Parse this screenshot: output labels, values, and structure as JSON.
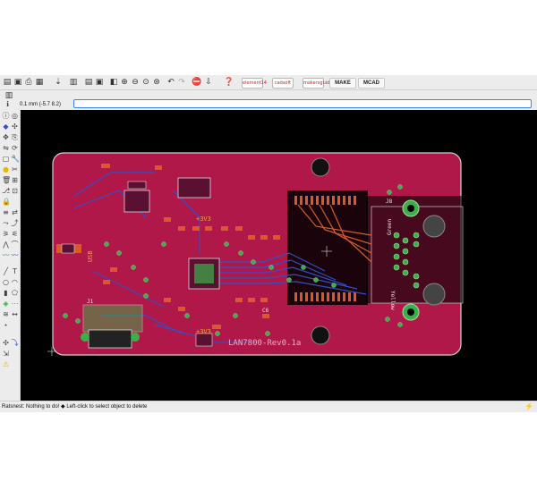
{
  "toolbar": {
    "badges": [
      "element14",
      "cadsoft",
      "makersguide"
    ],
    "make_label": "MAKE",
    "mcad_label": "MCAD"
  },
  "command_row": {
    "coordinate": "0.1 mm (-5.7 8.2)",
    "input_value": ""
  },
  "board": {
    "title": "LAN7800-Rev0.1a",
    "labels": {
      "j8": "J8",
      "green": "Green",
      "yellow": "Yellow",
      "usb": "USB",
      "v33_a": "+3V3",
      "v33_b": "+3V3",
      "c6": "C6",
      "j1": "J1"
    },
    "colors": {
      "board_fill": "#b0184a",
      "background": "#000000",
      "copper_pad": "#3bb048",
      "trace_blue": "#3050c8",
      "outline": "#d0d0d0"
    }
  },
  "status": {
    "text": "Ratsnest: Nothing to do! ◆ Left-click to select object to delete"
  }
}
